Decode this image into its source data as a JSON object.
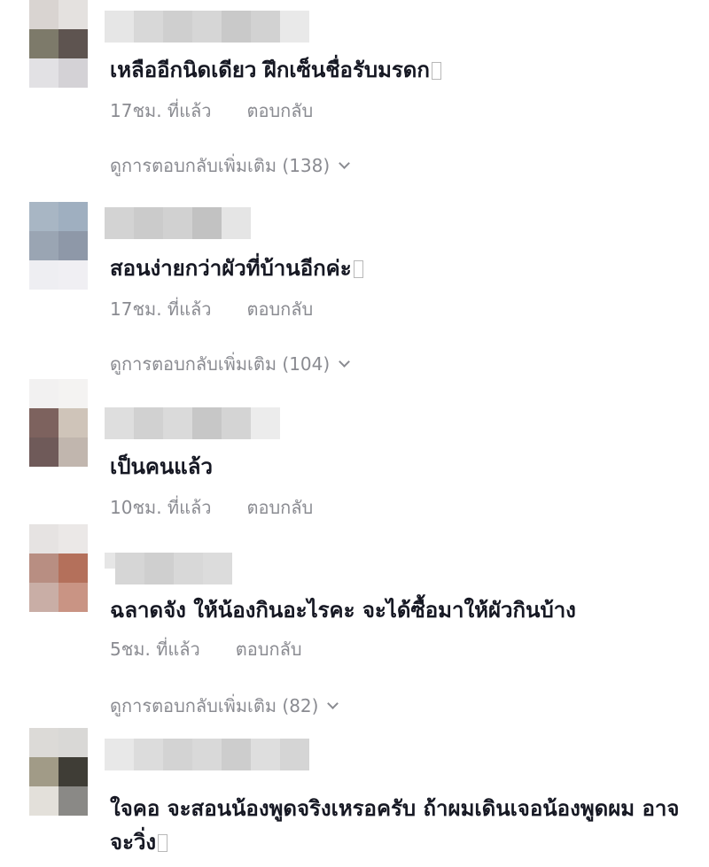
{
  "comments": [
    {
      "text": "เหลืออีกนิดเดียว ฝึกเซ็นชื่อรับมรดก",
      "time": "17ชม. ที่แล้ว",
      "reply_label": "ตอบกลับ",
      "more_replies": "ดูการตอบกลับเพิ่มเติม (138)"
    },
    {
      "text": "สอนง่ายกว่าผัวที่บ้านอีกค่ะ",
      "time": "17ชม. ที่แล้ว",
      "reply_label": "ตอบกลับ",
      "more_replies": "ดูการตอบกลับเพิ่มเติม (104)"
    },
    {
      "text": "เป็นคนแล้ว",
      "time": "10ชม. ที่แล้ว",
      "reply_label": "ตอบกลับ"
    },
    {
      "text": "ฉลาดจัง ให้น้องกินอะไรคะ จะได้ซื้อมาให้ผัวกินบ้าง",
      "time": "5ชม. ที่แล้ว",
      "reply_label": "ตอบกลับ",
      "more_replies": "ดูการตอบกลับเพิ่มเติม (82)"
    },
    {
      "text": "ใจคอ จะสอนน้องพูดจริงเหรอครับ ถ้าผมเดินเจอน้องพูดผม อาจจะวิ่ง"
    }
  ],
  "icons": {
    "more_chevron": "chevron-down-icon",
    "missing_glyph": "missing-glyph-icon"
  },
  "colors": {
    "text_primary": "#161823",
    "text_secondary": "#8a8b91",
    "background": "#ffffff"
  }
}
